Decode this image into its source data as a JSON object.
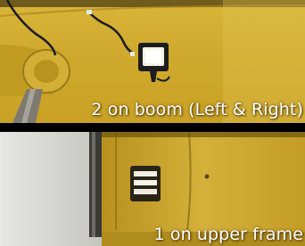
{
  "panels": [
    {
      "caption": "2 on boom (Left & Right)"
    },
    {
      "caption": "1 on upper frame"
    }
  ],
  "colors": {
    "machine_yellow": "#cfa92c",
    "background": "#000000",
    "caption_text": "#ffffff",
    "lamp_light": "#f4f1e6"
  }
}
